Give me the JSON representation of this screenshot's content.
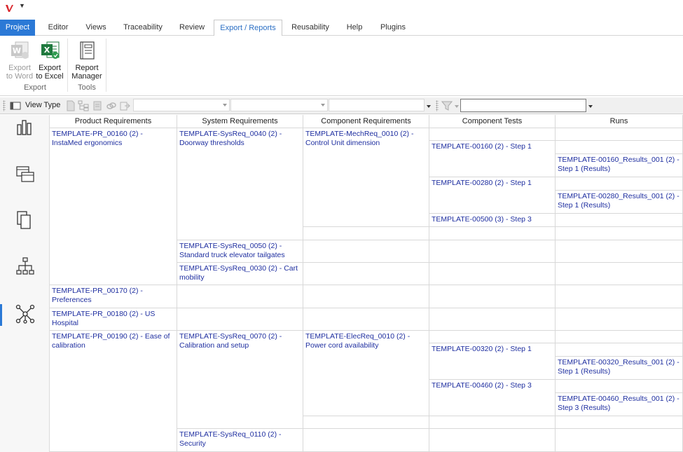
{
  "ribbon_tabs": [
    {
      "label": "Project"
    },
    {
      "label": "Editor"
    },
    {
      "label": "Views"
    },
    {
      "label": "Traceability"
    },
    {
      "label": "Review"
    },
    {
      "label": "Export / Reports"
    },
    {
      "label": "Reusability"
    },
    {
      "label": "Help"
    },
    {
      "label": "Plugins"
    }
  ],
  "ribbon": {
    "export_word": {
      "line1": "Export",
      "line2": "to Word"
    },
    "export_excel": {
      "line1": "Export",
      "line2": "to Excel"
    },
    "report_manager": {
      "line1": "Report",
      "line2": "Manager"
    },
    "group_export": "Export",
    "group_tools": "Tools"
  },
  "toolbar": {
    "view_type_label": "View Type",
    "filter_value": ""
  },
  "columns": [
    "Product Requirements",
    "System Requirements",
    "Component Requirements",
    "Component Tests",
    "Runs"
  ],
  "cells": {
    "pr_00160": "TEMPLATE-PR_00160 (2) - InstaMed ergonomics",
    "pr_00170": "TEMPLATE-PR_00170 (2) - Preferences",
    "pr_00180": "TEMPLATE-PR_00180 (2) - US Hospital",
    "pr_00190": "TEMPLATE-PR_00190 (2) - Ease of calibration",
    "sys_0040": "TEMPLATE-SysReq_0040 (2) - Doorway thresholds",
    "sys_0050": "TEMPLATE-SysReq_0050 (2) - Standard truck elevator tailgates",
    "sys_0030": "TEMPLATE-SysReq_0030 (2) - Cart mobility",
    "sys_0070": "TEMPLATE-SysReq_0070 (2) - Calibration and setup",
    "sys_0110": "TEMPLATE-SysReq_0110 (2) - Security",
    "comp_mech_0010": "TEMPLATE-MechReq_0010 (2) - Control Unit dimension",
    "comp_elec_0010": "TEMPLATE-ElecReq_0010 (2) - Power cord availability",
    "test_00160": "TEMPLATE-00160 (2) - Step 1",
    "test_00280": "TEMPLATE-00280 (2) - Step 1",
    "test_00500": "TEMPLATE-00500 (3) - Step 3",
    "test_00320": "TEMPLATE-00320 (2) - Step 1",
    "test_00460": "TEMPLATE-00460 (2) - Step 3",
    "run_00160": "TEMPLATE-00160_Results_001 (2) - Step 1 (Results)",
    "run_00280": "TEMPLATE-00280_Results_001 (2) - Step 1 (Results)",
    "run_00320": "TEMPLATE-00320_Results_001 (2) - Step 1 (Results)",
    "run_00460": "TEMPLATE-00460_Results_001 (2) - Step 3 (Results)"
  },
  "colors": {
    "accent": "#2b79d6",
    "link_text": "#1f2fa0",
    "excel_green": "#1f7a3e"
  },
  "icons": {
    "side_nav": [
      "bar-chart-icon",
      "nested-windows-icon",
      "pages-icon",
      "hierarchy-icon",
      "network-graph-icon"
    ]
  }
}
